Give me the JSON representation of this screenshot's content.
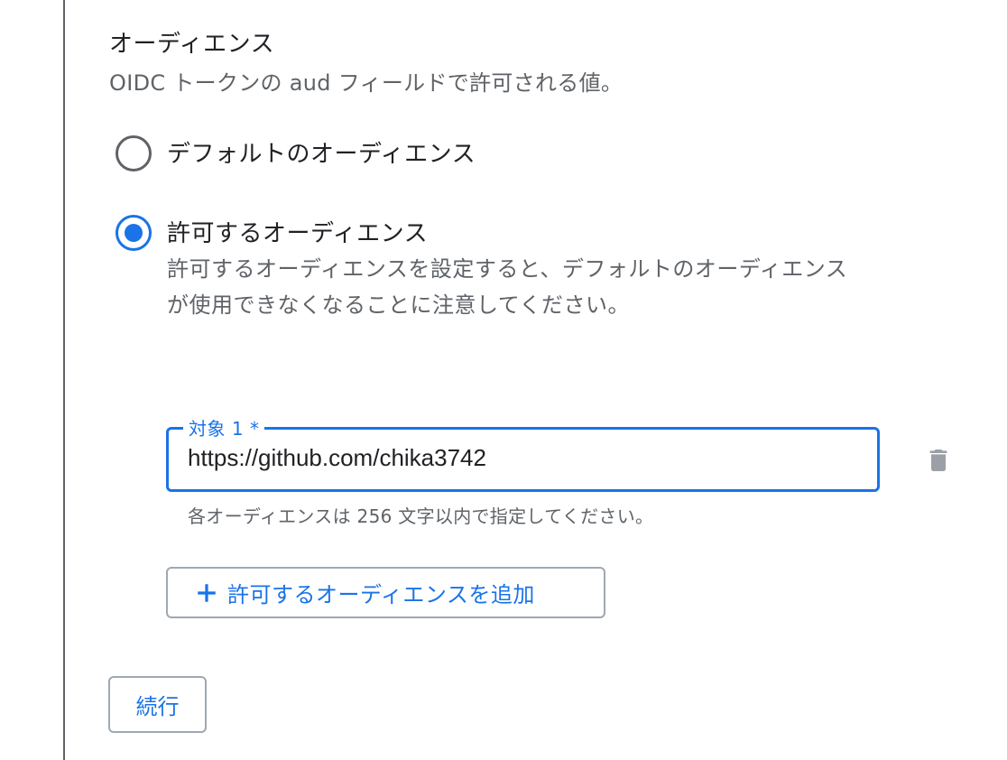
{
  "audience": {
    "title": "オーディエンス",
    "description": "OIDC トークンの aud フィールドで許可される値。",
    "options": {
      "default": {
        "label": "デフォルトのオーディエンス",
        "selected": false
      },
      "allowed": {
        "label": "許可するオーディエンス",
        "selected": true,
        "description_line1": "許可するオーディエンスを設定すると、デフォルトのオーディエンス",
        "description_line2": "が使用できなくなることに注意してください。"
      }
    },
    "fields": [
      {
        "label": "対象 1 *",
        "value": "https://github.com/chika3742"
      }
    ],
    "hint": "各オーディエンスは 256 文字以内で指定してください。",
    "add_button_label": "許可するオーディエンスを追加"
  },
  "continue_label": "続行",
  "colors": {
    "accent": "#1a73e8",
    "text_primary": "#202124",
    "text_secondary": "#5f6368",
    "icon_gray": "#9aa0a6"
  },
  "icons": {
    "delete": "trash-icon",
    "add": "plus-icon"
  }
}
